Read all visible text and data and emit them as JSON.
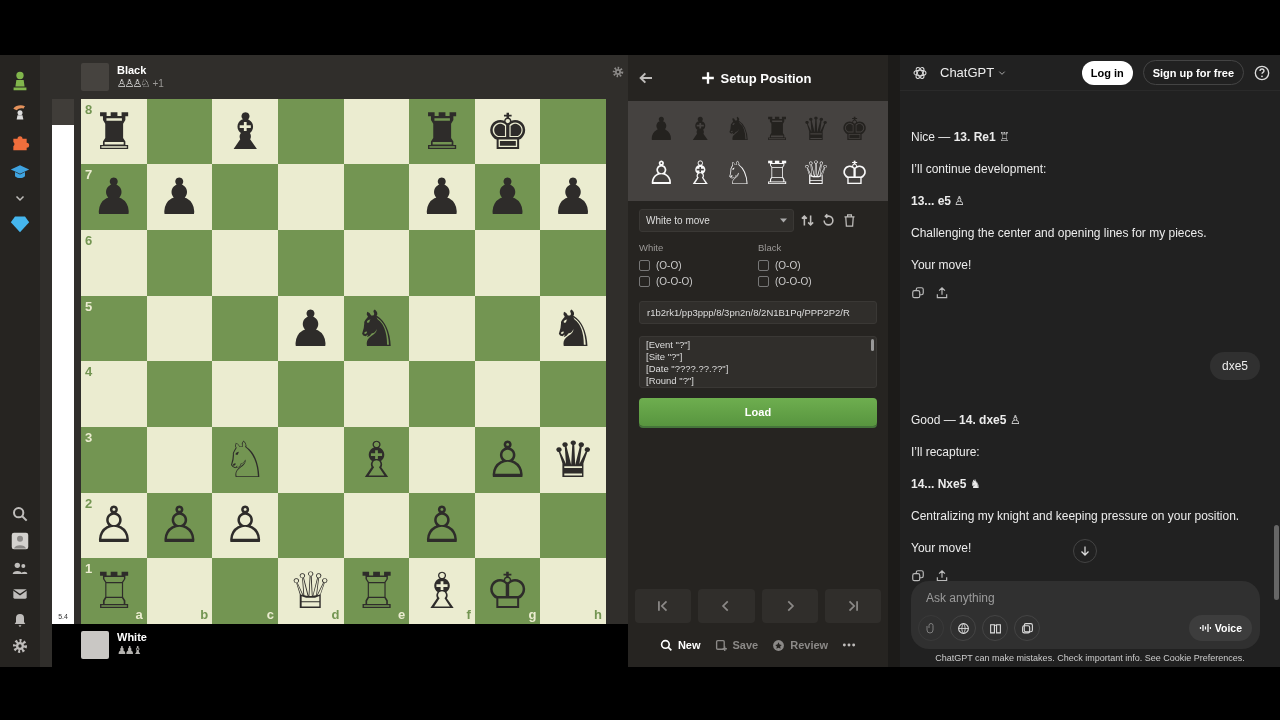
{
  "black_player": {
    "name": "Black",
    "captured": "♙♙♙♘",
    "advantage": "+1"
  },
  "eval": {
    "level": 0.95,
    "reading": "5.4"
  },
  "board": {
    "files": [
      "a",
      "b",
      "c",
      "d",
      "e",
      "f",
      "g",
      "h"
    ],
    "ranks": [
      {
        "label": "8",
        "squares": [
          {
            "kind": "piece",
            "piece": "♜"
          },
          {
            "kind": "empty"
          },
          {
            "kind": "piece",
            "piece": "♝"
          },
          {
            "kind": "empty"
          },
          {
            "kind": "empty"
          },
          {
            "kind": "piece",
            "piece": "♜"
          },
          {
            "kind": "piece",
            "piece": "♚"
          },
          {
            "kind": "empty"
          }
        ]
      },
      {
        "label": "7",
        "squares": [
          {
            "kind": "piece",
            "piece": "♟"
          },
          {
            "kind": "piece",
            "piece": "♟"
          },
          {
            "kind": "empty"
          },
          {
            "kind": "empty"
          },
          {
            "kind": "empty"
          },
          {
            "kind": "piece",
            "piece": "♟"
          },
          {
            "kind": "piece",
            "piece": "♟"
          },
          {
            "kind": "piece",
            "piece": "♟"
          }
        ]
      },
      {
        "label": "6",
        "squares": [
          {
            "kind": "empty"
          },
          {
            "kind": "empty"
          },
          {
            "kind": "empty"
          },
          {
            "kind": "empty"
          },
          {
            "kind": "empty"
          },
          {
            "kind": "empty"
          },
          {
            "kind": "empty"
          },
          {
            "kind": "empty"
          }
        ]
      },
      {
        "label": "5",
        "squares": [
          {
            "kind": "empty"
          },
          {
            "kind": "empty"
          },
          {
            "kind": "empty"
          },
          {
            "kind": "piece",
            "piece": "♟"
          },
          {
            "kind": "piece",
            "piece": "♞"
          },
          {
            "kind": "empty"
          },
          {
            "kind": "empty"
          },
          {
            "kind": "piece",
            "piece": "♞"
          }
        ]
      },
      {
        "label": "4",
        "squares": [
          {
            "kind": "empty"
          },
          {
            "kind": "empty"
          },
          {
            "kind": "empty"
          },
          {
            "kind": "empty"
          },
          {
            "kind": "empty"
          },
          {
            "kind": "empty"
          },
          {
            "kind": "empty"
          },
          {
            "kind": "empty"
          }
        ]
      },
      {
        "label": "3",
        "squares": [
          {
            "kind": "empty"
          },
          {
            "kind": "empty"
          },
          {
            "kind": "piece",
            "piece": "♘"
          },
          {
            "kind": "empty"
          },
          {
            "kind": "piece",
            "piece": "♗"
          },
          {
            "kind": "empty"
          },
          {
            "kind": "piece",
            "piece": "♙"
          },
          {
            "kind": "piece",
            "piece": "♛"
          }
        ]
      },
      {
        "label": "2",
        "squares": [
          {
            "kind": "piece",
            "piece": "♙"
          },
          {
            "kind": "piece",
            "piece": "♙"
          },
          {
            "kind": "piece",
            "piece": "♙"
          },
          {
            "kind": "empty"
          },
          {
            "kind": "empty"
          },
          {
            "kind": "piece",
            "piece": "♙"
          },
          {
            "kind": "empty"
          },
          {
            "kind": "empty"
          }
        ]
      },
      {
        "label": "1",
        "squares": [
          {
            "kind": "piece",
            "piece": "♖"
          },
          {
            "kind": "empty"
          },
          {
            "kind": "empty"
          },
          {
            "kind": "piece",
            "piece": "♕"
          },
          {
            "kind": "piece",
            "piece": "♖"
          },
          {
            "kind": "piece",
            "piece": "♗"
          },
          {
            "kind": "piece",
            "piece": "♔"
          },
          {
            "kind": "empty"
          }
        ]
      }
    ]
  },
  "white_player": {
    "name": "White",
    "captured": "♟♟♝"
  },
  "setup": {
    "title": "Setup Position",
    "palette": [
      "♟",
      "♝",
      "♞",
      "♜",
      "♛",
      "♚",
      "♙",
      "♗",
      "♘",
      "♖",
      "♕",
      "♔"
    ],
    "turn": "White to move",
    "castling": [
      {
        "label": "White",
        "options": [
          {
            "label": "(O-O)",
            "checked": false
          },
          {
            "label": "(O-O-O)",
            "checked": false
          }
        ]
      },
      {
        "label": "Black",
        "options": [
          {
            "label": "(O-O)",
            "checked": false
          },
          {
            "label": "(O-O-O)",
            "checked": false
          }
        ]
      }
    ],
    "fen": "r1b2rk1/pp3ppp/8/3pn2n/8/2N1B1Pq/PPP2P2/R",
    "pgn": [
      "[Event \"?\"]",
      "[Site \"?\"]",
      "[Date \"????.??.??\"]",
      "[Round \"?\"]"
    ],
    "load": "Load",
    "actions": [
      {
        "label": "New",
        "disabled": false
      },
      {
        "label": "Save",
        "disabled": true
      },
      {
        "label": "Review",
        "disabled": true
      }
    ]
  },
  "chat": {
    "brand": "ChatGPT",
    "login": "Log in",
    "signup": "Sign up for free",
    "messages": [
      {
        "kind": "text",
        "text": "Nice — **13. Re1** ♖"
      },
      {
        "kind": "text",
        "text": "I’ll continue development:"
      },
      {
        "kind": "text",
        "text": "**13... e5** ♙"
      },
      {
        "kind": "text",
        "text": "Challenging the center and opening lines for my pieces."
      },
      {
        "kind": "text",
        "text": "Your move!"
      },
      {
        "kind": "actions"
      },
      {
        "kind": "user",
        "text": "dxe5"
      },
      {
        "kind": "text",
        "text": "Good — **14. dxe5** ♙"
      },
      {
        "kind": "text",
        "text": "I’ll recapture:"
      },
      {
        "kind": "text",
        "text": "**14... Nxe5** ♞"
      },
      {
        "kind": "text",
        "text": "Centralizing my knight and keeping pressure on your position."
      },
      {
        "kind": "text",
        "text": "Your move!"
      },
      {
        "kind": "actions"
      }
    ],
    "composer": {
      "placeholder": "Ask anything",
      "voice": "Voice"
    },
    "disclaimer": "ChatGPT can make mistakes. Check important info. See Cookie Preferences."
  }
}
